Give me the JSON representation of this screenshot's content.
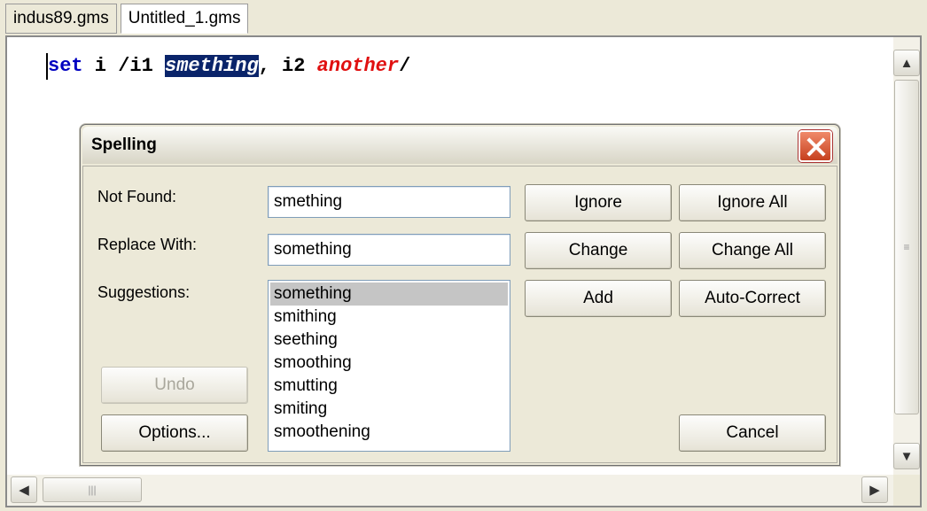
{
  "tabs": [
    "indus89.gms",
    "Untitled_1.gms"
  ],
  "code": {
    "kw": "set",
    "part1": " i /i1 ",
    "misspelled": "smething",
    "part2": ", i2 ",
    "error_word": "another",
    "end": "/"
  },
  "colors": {
    "keyword": "#0000c0",
    "selection": "#0a246a",
    "error": "#e01010"
  },
  "dialog": {
    "title": "Spelling",
    "not_found_label": "Not Found:",
    "replace_with_label": "Replace With:",
    "suggestions_label": "Suggestions:",
    "not_found_value": "smething",
    "replace_with_value": "something",
    "suggestions": [
      "something",
      "smithing",
      "seething",
      "smoothing",
      "smutting",
      "smiting",
      "smoothening"
    ],
    "selected_suggestion": "something",
    "buttons": {
      "ignore": "Ignore",
      "ignore_all": "Ignore All",
      "change": "Change",
      "change_all": "Change All",
      "add": "Add",
      "auto_correct": "Auto-Correct",
      "undo": "Undo",
      "options": "Options...",
      "cancel": "Cancel"
    }
  },
  "icons": {
    "close": "close-icon",
    "scroll_up": "chevron-up-icon",
    "scroll_down": "chevron-down-icon",
    "scroll_left": "chevron-left-icon",
    "scroll_right": "chevron-right-icon"
  }
}
